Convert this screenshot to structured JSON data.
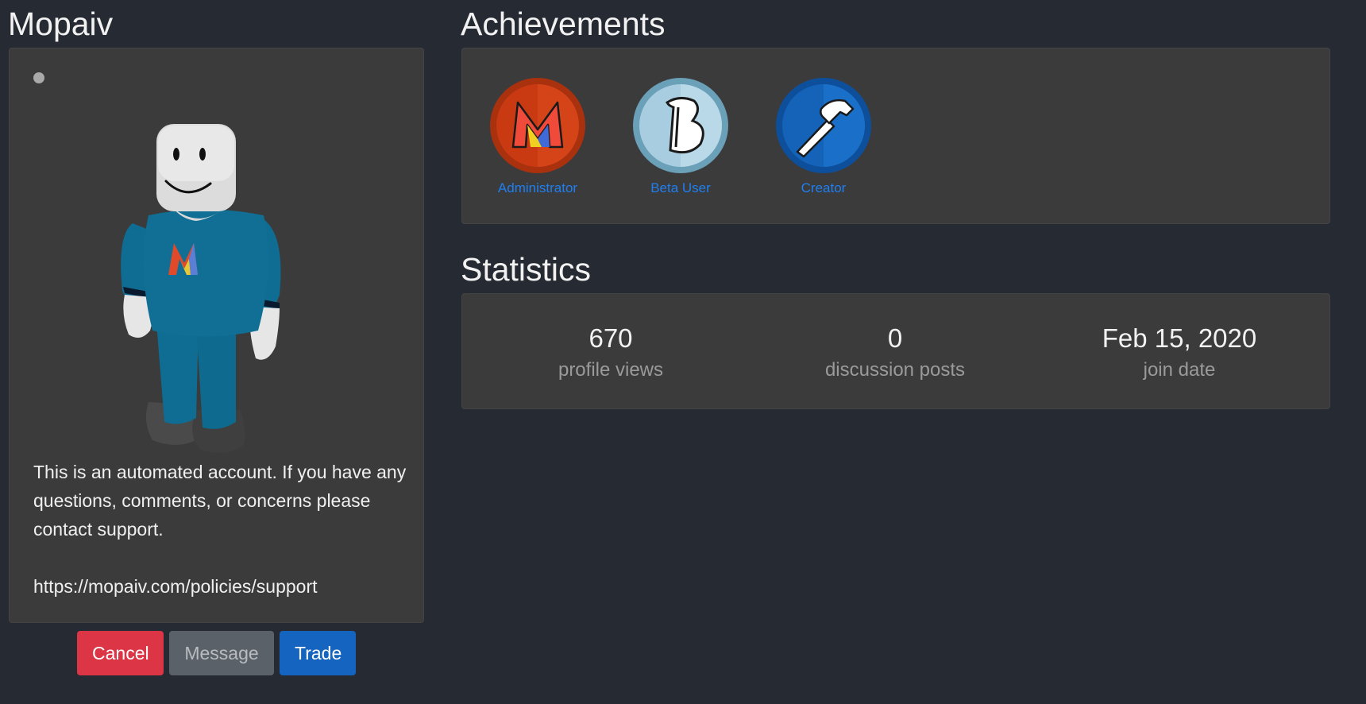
{
  "profile": {
    "username": "Mopaiv",
    "status": "offline",
    "blurb_text": "This is an automated account. If you have any questions, comments, or concerns please contact support.",
    "blurb_link": "https://mopaiv.com/policies/support",
    "shirt_logo_letter": "M"
  },
  "actions": {
    "cancel_label": "Cancel",
    "message_label": "Message",
    "trade_label": "Trade"
  },
  "achievements": {
    "title": "Achievements",
    "items": [
      {
        "label": "Administrator",
        "icon": "administrator-badge-icon",
        "glyph": "M",
        "color": "#c93a12"
      },
      {
        "label": "Beta User",
        "icon": "beta-user-badge-icon",
        "glyph": "B",
        "color": "#8fbfd6"
      },
      {
        "label": "Creator",
        "icon": "creator-hammer-badge-icon",
        "color": "#1565c0"
      }
    ]
  },
  "statistics": {
    "title": "Statistics",
    "items": [
      {
        "value": "670",
        "label": "profile views"
      },
      {
        "value": "0",
        "label": "discussion posts"
      },
      {
        "value": "Feb 15, 2020",
        "label": "join date"
      }
    ]
  },
  "colors": {
    "background": "#262a33",
    "panel": "#3b3b3b",
    "link": "#1f7ff0",
    "danger": "#dc3545",
    "secondary": "#5b6168",
    "primary": "#1565c0"
  }
}
